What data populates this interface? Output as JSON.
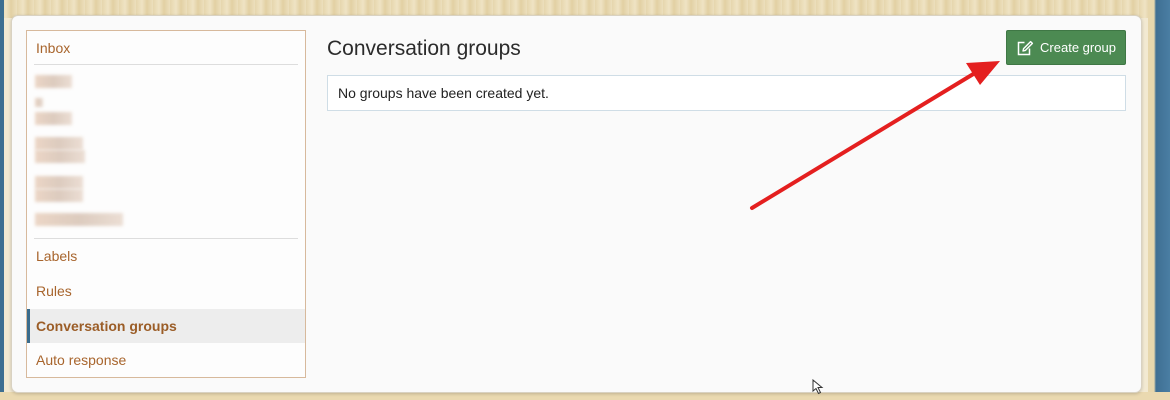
{
  "sidebar": {
    "items": [
      {
        "label": "Inbox"
      },
      {
        "label": "Labels"
      },
      {
        "label": "Rules"
      },
      {
        "label": "Conversation groups",
        "active": true
      },
      {
        "label": "Auto response"
      }
    ]
  },
  "main": {
    "title": "Conversation groups",
    "empty_message": "No groups have been created yet."
  },
  "toolbar": {
    "create_label": "Create group",
    "create_icon": "edit-icon"
  },
  "colors": {
    "primary_button": "#4c8a52",
    "sidebar_link": "#a8652d",
    "active_indicator": "#3a6c8c",
    "annotation_arrow": "#e41f1f"
  }
}
